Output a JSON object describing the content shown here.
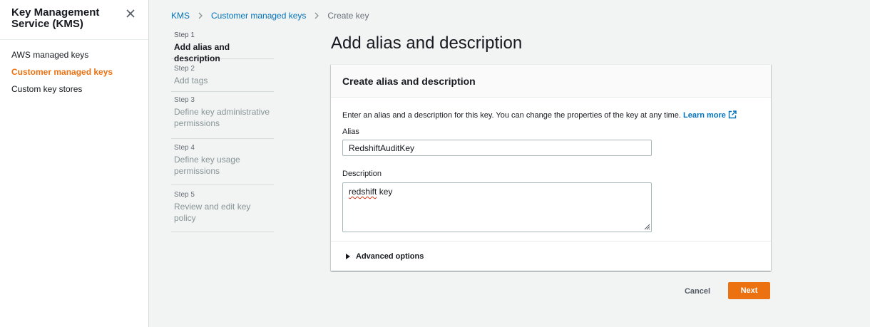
{
  "sidebar": {
    "title": "Key Management Service (KMS)",
    "close_icon": "close-icon",
    "items": [
      {
        "label": "AWS managed keys",
        "active": false
      },
      {
        "label": "Customer managed keys",
        "active": true
      },
      {
        "label": "Custom key stores",
        "active": false
      }
    ]
  },
  "breadcrumb": {
    "items": [
      "KMS",
      "Customer managed keys",
      "Create key"
    ]
  },
  "steps": [
    {
      "num": "Step 1",
      "label": "Add alias and description"
    },
    {
      "num": "Step 2",
      "label": "Add tags"
    },
    {
      "num": "Step 3",
      "label": "Define key administrative permissions"
    },
    {
      "num": "Step 4",
      "label": "Define key usage permissions"
    },
    {
      "num": "Step 5",
      "label": "Review and edit key policy"
    }
  ],
  "page": {
    "title": "Add alias and description"
  },
  "panel": {
    "title": "Create alias and description",
    "description": "Enter an alias and a description for this key. You can change the properties of the key at any time.",
    "learn_more": "Learn more",
    "alias_label": "Alias",
    "alias_value": "RedshiftAuditKey",
    "description_label": "Description",
    "description_word1": "redshift",
    "description_word2": " key",
    "advanced_options": "Advanced options"
  },
  "actions": {
    "cancel": "Cancel",
    "next": "Next"
  },
  "colors": {
    "accent": "#ec7211",
    "link": "#0073bb"
  }
}
